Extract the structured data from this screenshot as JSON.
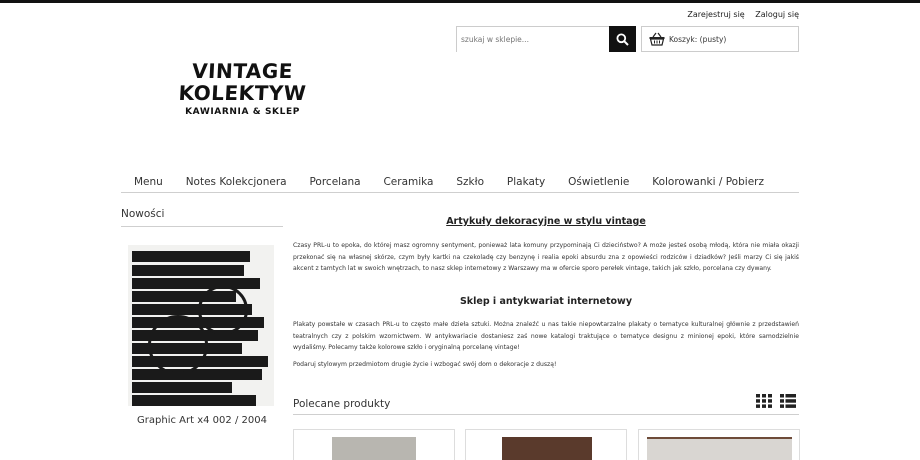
{
  "account": {
    "register": "Zarejestruj się",
    "login": "Zaloguj się"
  },
  "search": {
    "placeholder": "szukaj w sklepie...",
    "button_icon": "search-icon"
  },
  "cart": {
    "label": "Koszyk: (pusty)",
    "icon": "basket-icon"
  },
  "logo": {
    "line1": "VINTAGE",
    "line2": "KOLEKTYW",
    "line3": "KAWIARNIA & SKLEP"
  },
  "nav": [
    "Menu",
    "Notes Kolekcjonera",
    "Porcelana",
    "Ceramika",
    "Szkło",
    "Plakaty",
    "Oświetlenie",
    "Kolorowanki / Pobierz"
  ],
  "sidebar": {
    "title": "Nowości",
    "product": {
      "name": "Graphic Art x4 002 / 2004"
    }
  },
  "main": {
    "heading1": "Artykuły dekoracyjne w stylu vintage",
    "para1": "Czasy PRL-u to epoka, do której masz ogromny sentyment, ponieważ lata komuny przypominają Ci dzieciństwo? A może jesteś osobą młodą, która nie miała okazji przekonać się na własnej skórze, czym były kartki na czekoladę czy benzynę i realia epoki absurdu zna z opowieści rodziców i dziadków? Jeśli marzy Ci się jakiś akcent z tamtych lat w swoich wnętrzach, to nasz sklep internetowy z Warszawy ma w ofercie sporo perełek vintage, takich jak szkło, porcelana czy dywany.",
    "heading2": "Sklep i antykwariat internetowy",
    "para2": "Plakaty powstałe w czasach PRL-u to często małe dzieła sztuki. Można znaleźć u nas takie niepowtarzalne plakaty o tematyce kulturalnej głównie z przedstawień teatralnych czy z polskim wzornictwem. W antykwariacie dostaniesz zaś nowe katalogi traktujące o tematyce designu z minionej epoki, które samodzielnie wydaliśmy. Polecamy także kolorowe szkło i oryginalną porcelanę vintage!",
    "para3": "Podaruj stylowym przedmiotom drugie życie i wzbogać swój dom o dekoracje z duszą!",
    "featured_title": "Polecane produkty"
  }
}
